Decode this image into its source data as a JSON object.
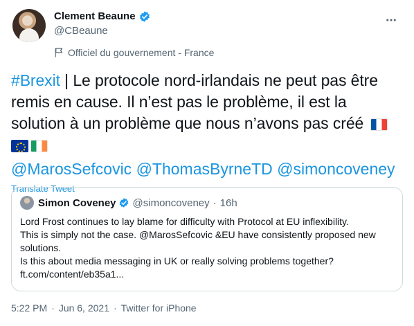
{
  "author": {
    "display_name": "Clement Beaune",
    "handle": "@CBeaune",
    "affiliation": "Officiel du gouvernement - France"
  },
  "tweet": {
    "hashtag": "#Brexit",
    "text": " | Le protocole nord-irlandais ne peut pas être remis en cause. Il n’est pas le problème, il est la solution à un problème que nous n’avons pas créé",
    "mentions": [
      "@MarosSefcovic",
      "@ThomasByrneTD",
      "@simoncoveney"
    ],
    "translate_label": "Translate Tweet"
  },
  "quoted_tweet": {
    "display_name": "Simon Coveney",
    "handle": "@simoncoveney",
    "separator": "·",
    "time": "16h",
    "text_lines": [
      "Lord Frost continues to lay blame for difficulty with Protocol at EU inflexibility.",
      "This is simply not the case. @MarosSefcovic &EU have consistently proposed new solutions.",
      "Is this about media messaging in UK or really solving problems together? ft.com/content/eb35a1..."
    ]
  },
  "footer": {
    "time": "5:22 PM",
    "separator1": "·",
    "date": "Jun 6, 2021",
    "separator2": "·",
    "source": "Twitter for iPhone"
  },
  "icons": {
    "verified": "verified-badge-icon",
    "more": "more-options-icon",
    "label": "government-label-icon",
    "flags": [
      "flag-france-icon",
      "flag-eu-icon",
      "flag-ireland-icon"
    ]
  },
  "colors": {
    "link": "#1b95e0",
    "verified": "#1d9bf0",
    "secondary_text": "#536471",
    "border": "#cfd9de"
  }
}
